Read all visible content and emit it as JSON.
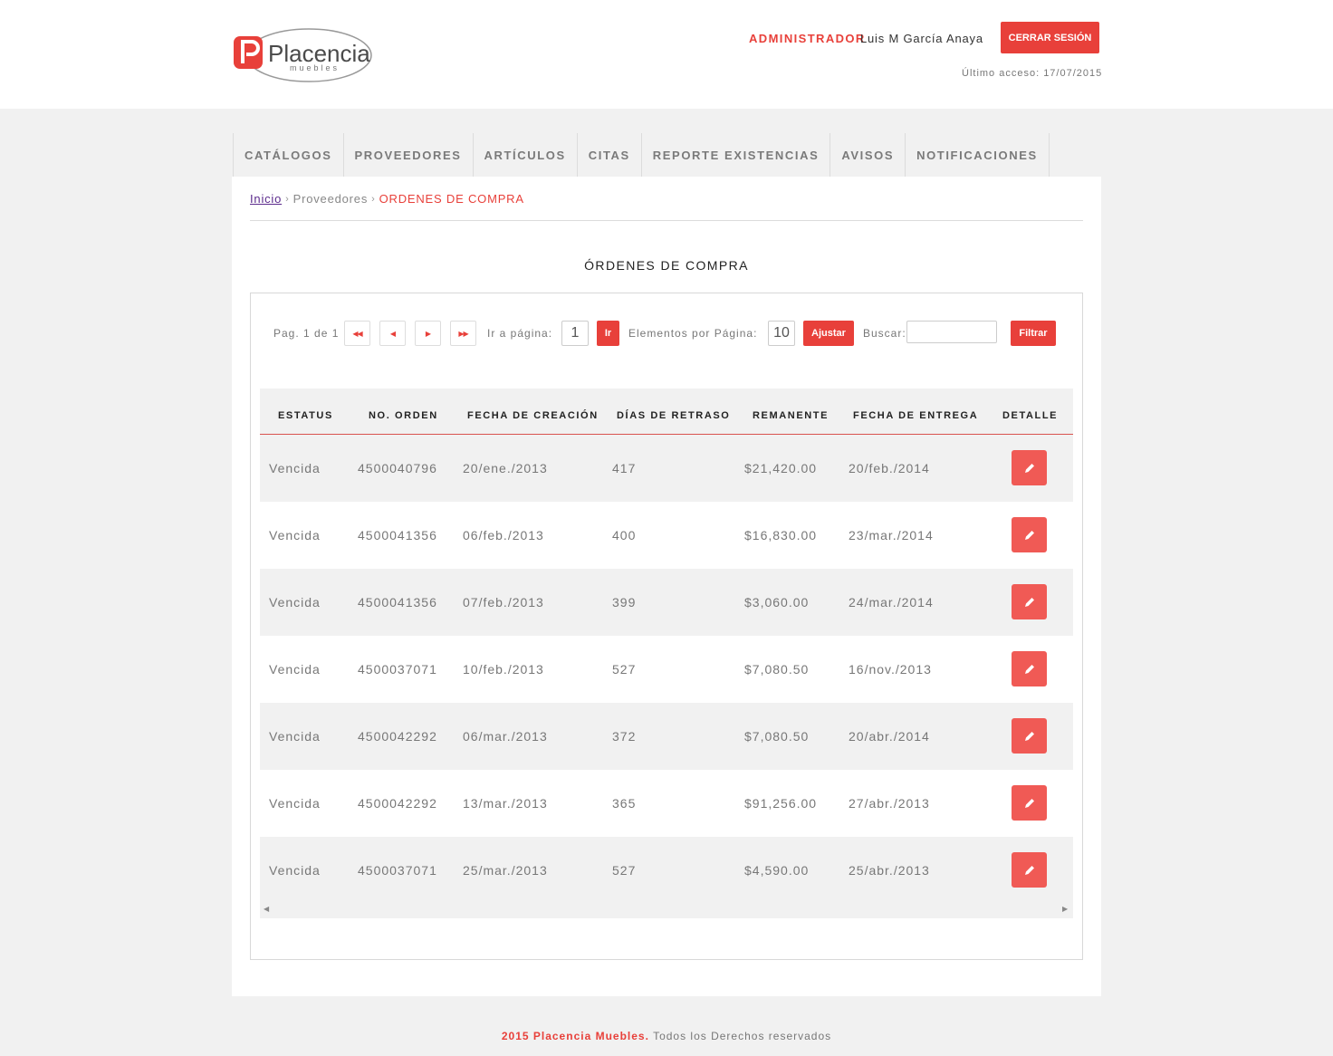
{
  "header": {
    "logo_text": "Placencia",
    "logo_sub": "muebles",
    "role_label": "ADMINISTRADOR",
    "user_name": "Luis M García Anaya",
    "logout_label": "CERRAR SESIÓN",
    "last_access": "Último acceso: 17/07/2015"
  },
  "nav": {
    "items": [
      {
        "label": "CATÁLOGOS"
      },
      {
        "label": "PROVEEDORES"
      },
      {
        "label": "ARTÍCULOS"
      },
      {
        "label": "CITAS"
      },
      {
        "label": "REPORTE EXISTENCIAS"
      },
      {
        "label": "AVISOS"
      },
      {
        "label": "NOTIFICACIONES"
      }
    ]
  },
  "breadcrumb": {
    "home": "Inicio",
    "middle": "Proveedores",
    "current": "ORDENES DE COMPRA"
  },
  "page_title": "ÓRDENES DE COMPRA",
  "pager": {
    "page_info": "Pag. 1 de 1",
    "goto_label": "Ir a página:",
    "goto_value": "1",
    "goto_button": "Ir",
    "per_page_label": "Elementos por Página:",
    "per_page_value": "10",
    "adjust_button": "Ajustar",
    "search_label": "Buscar:",
    "search_value": "",
    "filter_button": "Filtrar"
  },
  "table": {
    "columns": [
      "ESTATUS",
      "NO. ORDEN",
      "FECHA DE CREACIÓN",
      "DÍAS DE RETRASO",
      "REMANENTE",
      "FECHA DE ENTREGA",
      "DETALLE"
    ],
    "rows": [
      {
        "estatus": "Vencida",
        "orden": "4500040796",
        "creacion": "20/ene./2013",
        "retraso": "417",
        "remanente": "$21,420.00",
        "entrega": "20/feb./2014"
      },
      {
        "estatus": "Vencida",
        "orden": "4500041356",
        "creacion": "06/feb./2013",
        "retraso": "400",
        "remanente": "$16,830.00",
        "entrega": "23/mar./2014"
      },
      {
        "estatus": "Vencida",
        "orden": "4500041356",
        "creacion": "07/feb./2013",
        "retraso": "399",
        "remanente": "$3,060.00",
        "entrega": "24/mar./2014"
      },
      {
        "estatus": "Vencida",
        "orden": "4500037071",
        "creacion": "10/feb./2013",
        "retraso": "527",
        "remanente": "$7,080.50",
        "entrega": "16/nov./2013"
      },
      {
        "estatus": "Vencida",
        "orden": "4500042292",
        "creacion": "06/mar./2013",
        "retraso": "372",
        "remanente": "$7,080.50",
        "entrega": "20/abr./2014"
      },
      {
        "estatus": "Vencida",
        "orden": "4500042292",
        "creacion": "13/mar./2013",
        "retraso": "365",
        "remanente": "$91,256.00",
        "entrega": "27/abr./2013"
      },
      {
        "estatus": "Vencida",
        "orden": "4500037071",
        "creacion": "25/mar./2013",
        "retraso": "527",
        "remanente": "$4,590.00",
        "entrega": "25/abr./2013"
      }
    ]
  },
  "footer": {
    "brand": "2015 Placencia Muebles.",
    "rest": "Todos los Derechos reservados"
  },
  "colors": {
    "accent": "#e8403a",
    "edit_button": "#f05a55",
    "background": "#f1f1f1"
  }
}
